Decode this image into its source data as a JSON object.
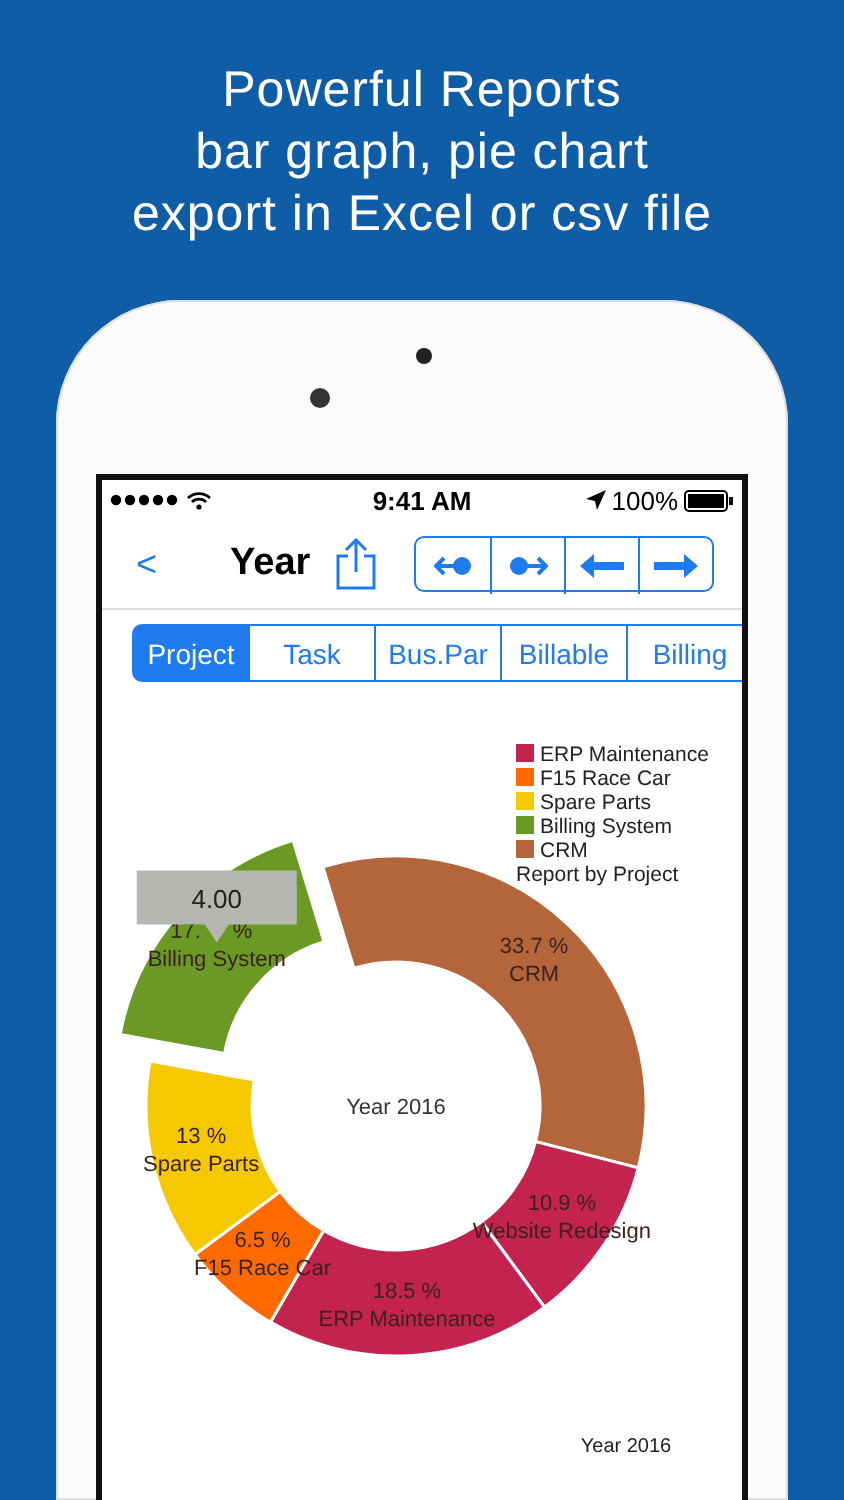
{
  "headline": [
    "Powerful Reports",
    "bar graph, pie chart",
    "export in Excel or csv file"
  ],
  "status_bar": {
    "time": "9:41 AM",
    "battery": "100%"
  },
  "nav": {
    "back": "<",
    "title": "Year"
  },
  "tabs": [
    {
      "label": "Project",
      "selected": true
    },
    {
      "label": "Task",
      "selected": false
    },
    {
      "label": "Bus.Par",
      "selected": false
    },
    {
      "label": "Billable",
      "selected": false
    },
    {
      "label": "Billing",
      "selected": false
    }
  ],
  "chart": {
    "legend": [
      {
        "label": "ERP Maintenance",
        "color": "#c4234f"
      },
      {
        "label": "F15 Race Car",
        "color": "#ff6a00"
      },
      {
        "label": "Spare Parts",
        "color": "#f5c800"
      },
      {
        "label": "Billing System",
        "color": "#6a9a24"
      },
      {
        "label": "CRM",
        "color": "#b5653a"
      }
    ],
    "legend_title": "Report by Project",
    "center_label": "Year 2016",
    "footer": "Year 2016",
    "slice_states": [
      {
        "exploded": false
      },
      {
        "exploded": false
      },
      {
        "exploded": false
      },
      {
        "exploded": false
      },
      {
        "exploded": false
      },
      {
        "exploded": true,
        "tooltip": "4.00"
      }
    ],
    "chart_data": {
      "type": "donut",
      "categories": [
        "CRM",
        "Website Redesign",
        "ERP Maintenance",
        "F15 Race Car",
        "Spare Parts",
        "Billing System"
      ],
      "values": [
        33.7,
        10.9,
        18.5,
        6.5,
        13,
        17.4
      ],
      "colors": [
        "#b5653a",
        "#c4234f",
        "#c4234f",
        "#ff6a00",
        "#f5c800",
        "#6a9a24"
      ],
      "data_labels": true,
      "value_labels": [
        "33.7 %",
        "10.9 %",
        "18.5 %",
        "6.5 %",
        "13 %",
        "17. %"
      ]
    }
  }
}
